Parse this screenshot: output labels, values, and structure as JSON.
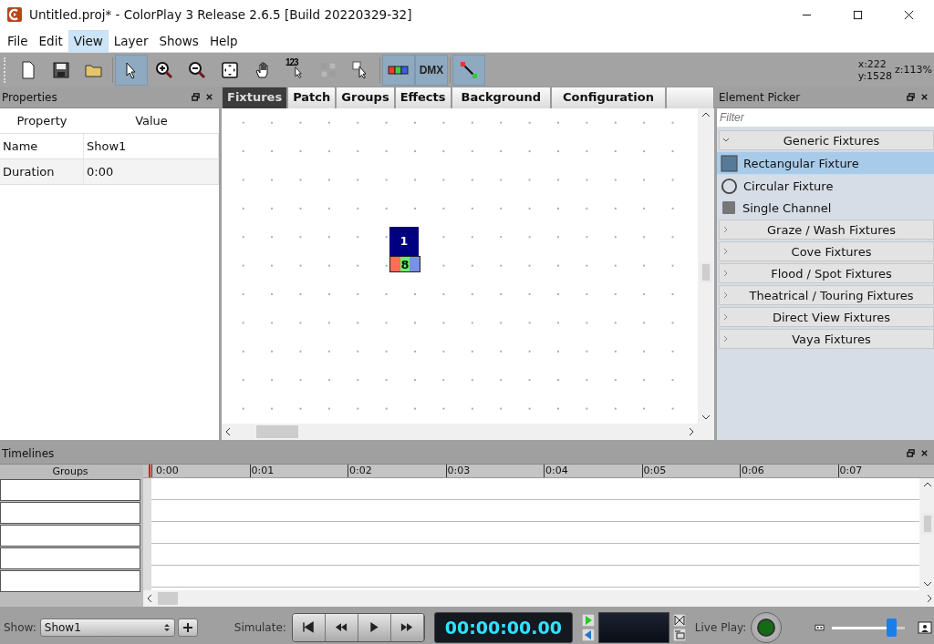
{
  "window": {
    "title": "Untitled.proj* - ColorPlay 3 Release 2.6.5 [Build 20220329-32]"
  },
  "menu": [
    {
      "label": "File",
      "selected": false
    },
    {
      "label": "Edit",
      "selected": false
    },
    {
      "label": "View",
      "selected": true
    },
    {
      "label": "Layer",
      "selected": false
    },
    {
      "label": "Shows",
      "selected": false
    },
    {
      "label": "Help",
      "selected": false
    }
  ],
  "toolbar": {
    "buttons": [
      {
        "kind": "new",
        "selected": false
      },
      {
        "kind": "save",
        "selected": false
      },
      {
        "kind": "open",
        "selected": false
      },
      {
        "kind": "pointer",
        "selected": true
      },
      {
        "kind": "zoom-in",
        "selected": false
      },
      {
        "kind": "zoom-out",
        "selected": false
      },
      {
        "kind": "fit",
        "selected": false
      },
      {
        "kind": "hand",
        "selected": false
      },
      {
        "kind": "number",
        "label": "123",
        "selected": false
      },
      {
        "kind": "grid",
        "selected": false,
        "disabled": true
      },
      {
        "kind": "select-area",
        "selected": false
      },
      {
        "kind": "color",
        "selected": true
      },
      {
        "kind": "dmx",
        "label": "DMX",
        "selected": true
      },
      {
        "kind": "connect",
        "selected": true
      }
    ],
    "coords": {
      "x": "x:222",
      "y": "y:1528",
      "zoom": "z:113%"
    }
  },
  "properties": {
    "title": "Properties",
    "columns": [
      "Property",
      "Value"
    ],
    "rows": [
      {
        "name": "Name",
        "value": "Show1"
      },
      {
        "name": "Duration",
        "value": "0:00"
      }
    ]
  },
  "canvas": {
    "tabs": [
      {
        "label": "Fixtures",
        "selected": true
      },
      {
        "label": "Patch",
        "selected": false
      },
      {
        "label": "Groups",
        "selected": false
      },
      {
        "label": "Effects",
        "selected": false
      },
      {
        "label": "Background",
        "selected": false
      },
      {
        "label": "Configuration",
        "selected": false
      }
    ],
    "fixture": {
      "number": "1",
      "channel": "8"
    }
  },
  "element_picker": {
    "title": "Element Picker",
    "filter_placeholder": "Filter",
    "groups": [
      {
        "label": "Generic Fixtures",
        "expanded": true,
        "children": [
          {
            "label": "Rectangular Fixture",
            "kind": "rect",
            "selected": true
          },
          {
            "label": "Circular Fixture",
            "kind": "circle",
            "selected": false
          },
          {
            "label": "Single Channel",
            "kind": "square",
            "selected": false
          }
        ]
      },
      {
        "label": "Graze / Wash Fixtures",
        "expanded": false
      },
      {
        "label": "Cove Fixtures",
        "expanded": false
      },
      {
        "label": "Flood / Spot Fixtures",
        "expanded": false
      },
      {
        "label": "Theatrical / Touring Fixtures",
        "expanded": false
      },
      {
        "label": "Direct View Fixtures",
        "expanded": false
      },
      {
        "label": "Vaya Fixtures",
        "expanded": false
      }
    ]
  },
  "timelines": {
    "title": "Timelines",
    "groups_heading": "Groups",
    "ticks": [
      "0:00",
      "0:01",
      "0:02",
      "0:03",
      "0:04",
      "0:05",
      "0:06",
      "0:07"
    ]
  },
  "transport": {
    "show_label": "Show:",
    "show_value": "Show1",
    "simulate_label": "Simulate:",
    "time": "00:00:00.00",
    "live_play_label": "Live Play:",
    "zoom": {
      "level": 0.82
    }
  }
}
